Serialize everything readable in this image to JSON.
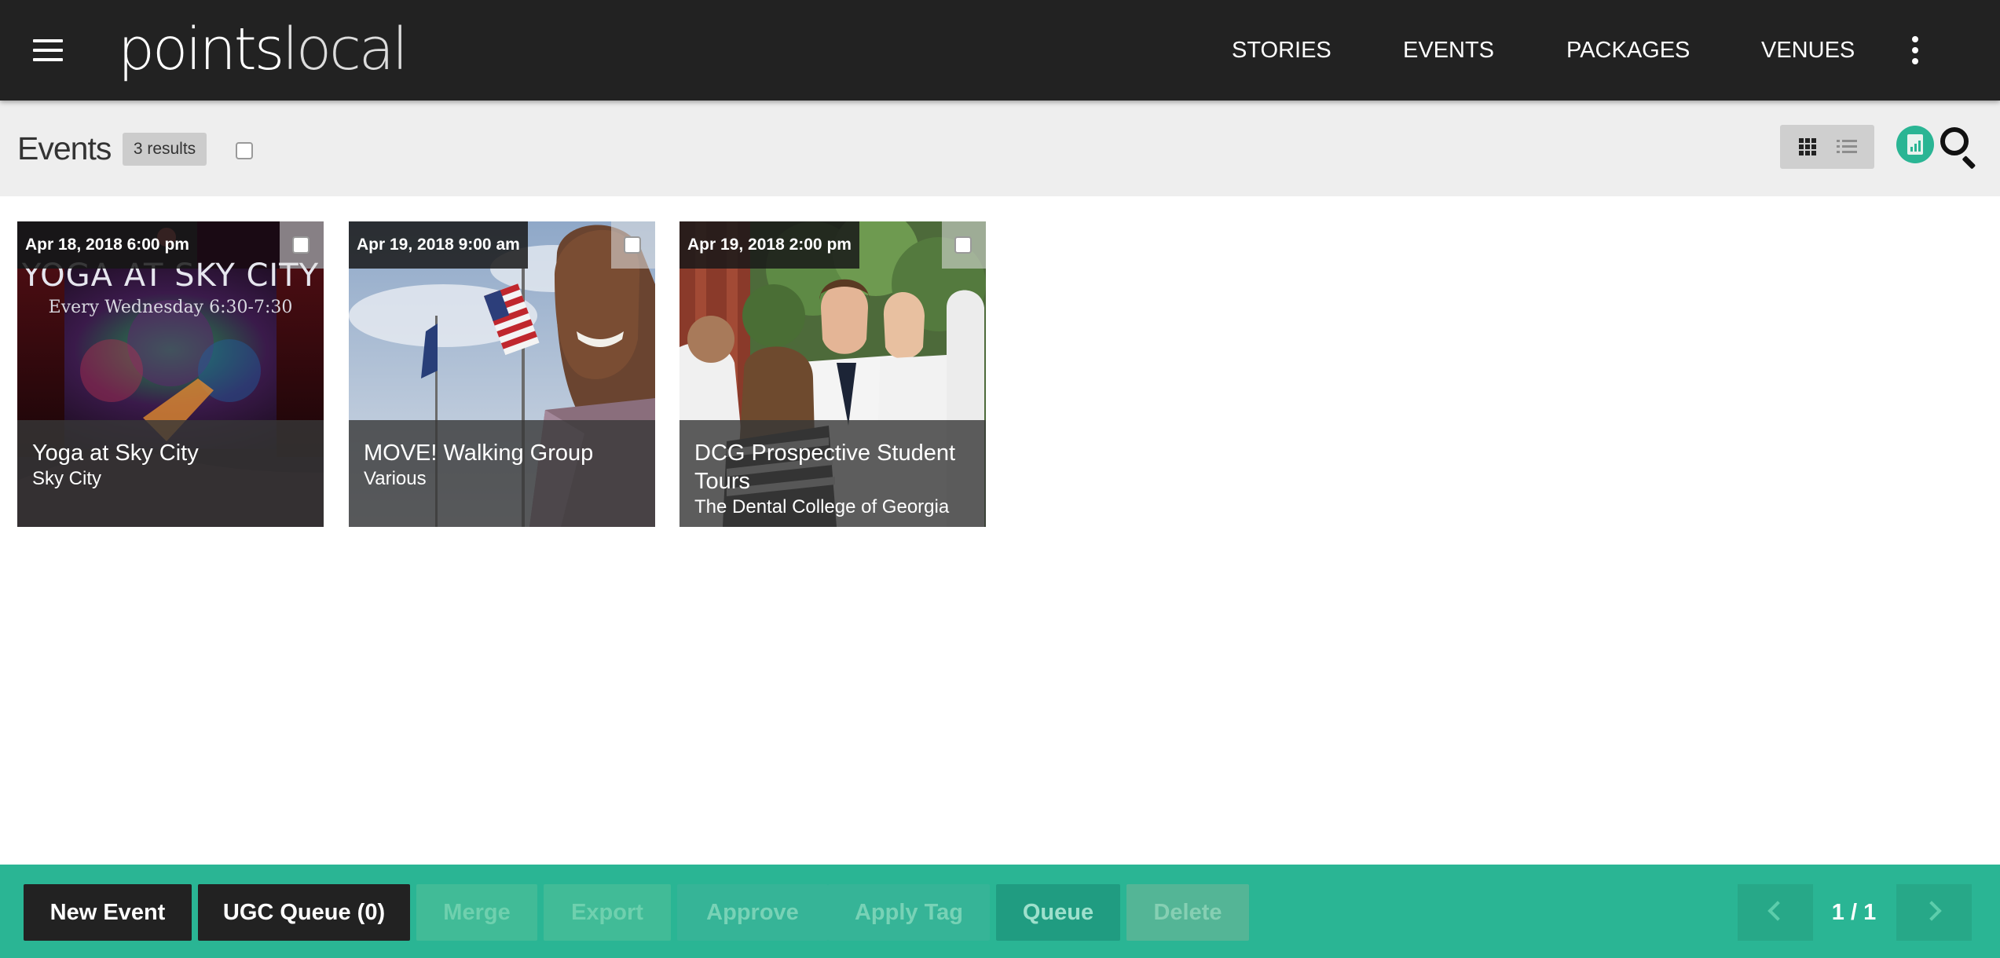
{
  "header": {
    "logo_bold": "points",
    "logo_light": "local",
    "nav": [
      "STORIES",
      "EVENTS",
      "PACKAGES",
      "VENUES"
    ]
  },
  "page": {
    "title": "Events",
    "results": "3 results"
  },
  "events": [
    {
      "date": "Apr 18, 2018 6:00 pm",
      "name": "Yoga at Sky City",
      "venue": "Sky City",
      "poster_line1": "YOGA AT SKY CITY",
      "poster_line2": "Every Wednesday 6:30-7:30"
    },
    {
      "date": "Apr 19, 2018 9:00 am",
      "name": "MOVE! Walking Group",
      "venue": "Various"
    },
    {
      "date": "Apr 19, 2018 2:00 pm",
      "name": "DCG Prospective Student Tours",
      "venue": "The Dental College of Georgia"
    }
  ],
  "actions": {
    "new_event": "New Event",
    "ugc_queue": "UGC Queue (0)",
    "merge": "Merge",
    "export": "Export",
    "approve": "Approve",
    "apply_tag": "Apply Tag",
    "queue": "Queue",
    "delete": "Delete"
  },
  "pagination": {
    "label": "1 / 1"
  },
  "colors": {
    "topbar": "#222222",
    "accent": "#2ab594",
    "subbar": "#eeeeee"
  },
  "icons": [
    "menu-icon",
    "more-vertical-icon",
    "grid-view-icon",
    "list-view-icon",
    "report-icon",
    "search-icon",
    "chevron-left-icon",
    "chevron-right-icon"
  ]
}
